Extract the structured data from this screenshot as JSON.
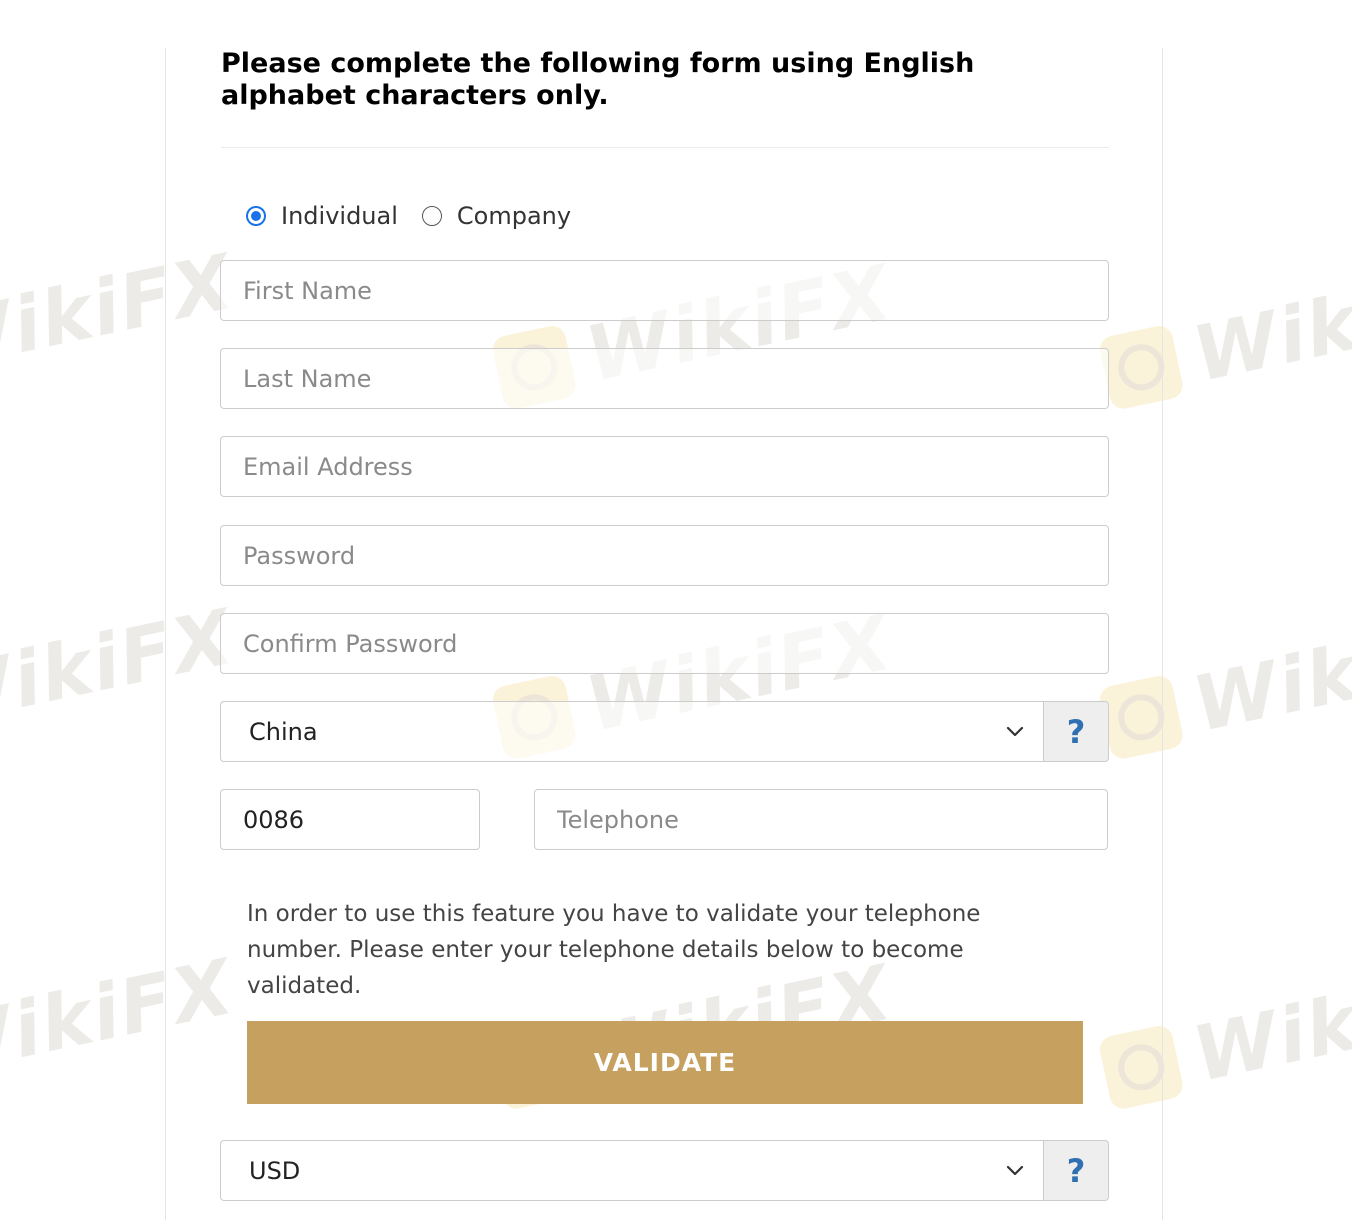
{
  "watermark": {
    "text": "WikiFX"
  },
  "form": {
    "heading": "Please complete the following form using English alphabet characters only.",
    "account_type": {
      "options": [
        {
          "label": "Individual",
          "checked": true
        },
        {
          "label": "Company",
          "checked": false
        }
      ]
    },
    "fields": {
      "first_name": {
        "placeholder": "First Name",
        "value": ""
      },
      "last_name": {
        "placeholder": "Last Name",
        "value": ""
      },
      "email": {
        "placeholder": "Email Address",
        "value": ""
      },
      "password": {
        "placeholder": "Password",
        "value": ""
      },
      "confirm_password": {
        "placeholder": "Confirm Password",
        "value": ""
      }
    },
    "country_select": {
      "value": "China",
      "help_label": "?"
    },
    "phone": {
      "code_value": "0086",
      "telephone_placeholder": "Telephone"
    },
    "validation_info": "In order to use this feature you have to validate your telephone number. Please enter your telephone details below to become validated.",
    "validate_button": "VALIDATE",
    "currency_select": {
      "value": "USD",
      "help_label": "?"
    }
  },
  "colors": {
    "accent_gold": "#c49d5a",
    "radio_blue": "#1a73e8",
    "help_blue": "#2f6fb2"
  }
}
